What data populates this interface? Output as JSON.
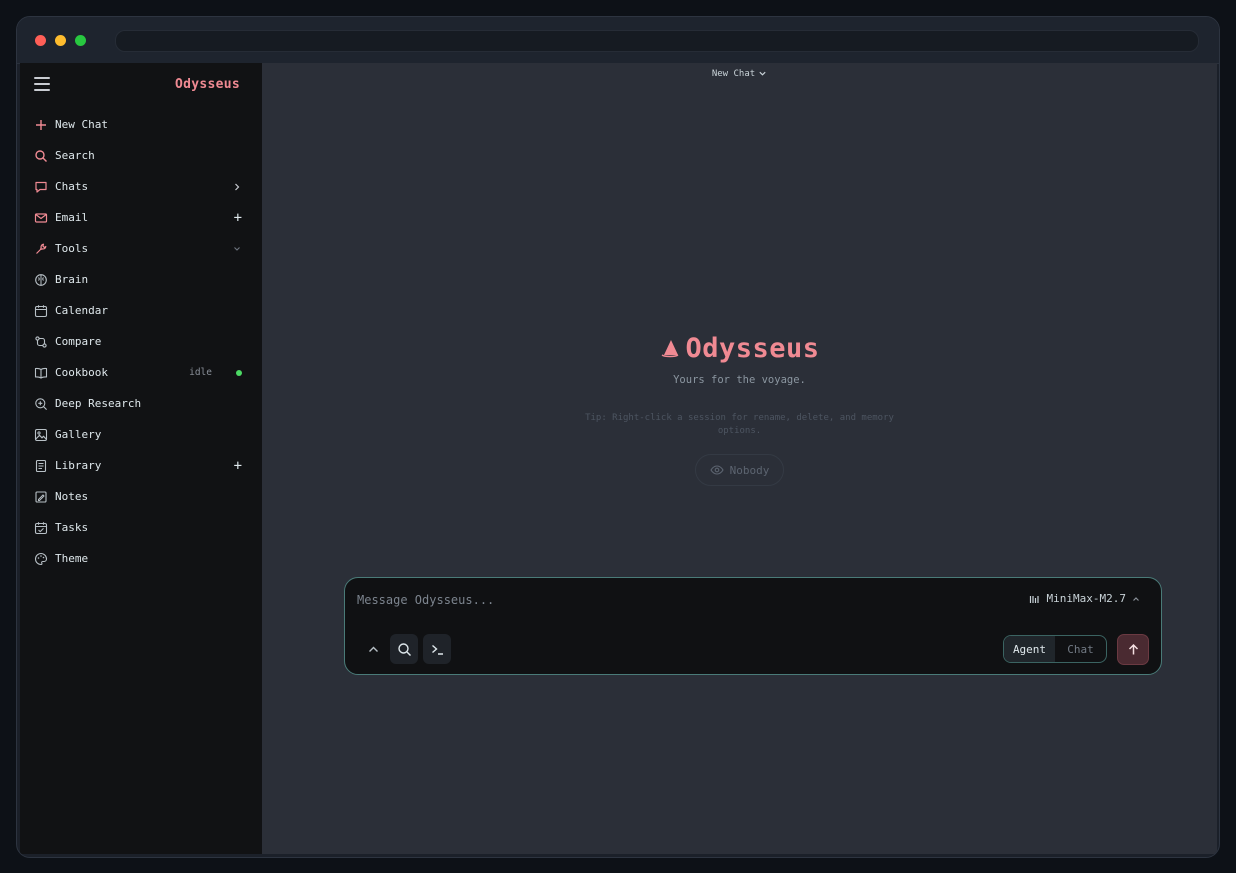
{
  "colors": {
    "accent": "#f08a93",
    "sidebar_bg": "#111214",
    "main_bg": "#2b2f38",
    "composer_border": "#4a7b78",
    "status_idle": "#4cd964"
  },
  "sidebar": {
    "brand": "Odysseus",
    "menu_icon": "hamburger-icon",
    "items": [
      {
        "label": "New Chat",
        "icon": "plus-icon"
      },
      {
        "label": "Search",
        "icon": "search-icon"
      },
      {
        "label": "Chats",
        "icon": "chat-bubble-icon",
        "right": "chevron-right"
      },
      {
        "label": "Email",
        "icon": "mail-icon",
        "right": "plus"
      },
      {
        "label": "Tools",
        "icon": "wrench-icon",
        "right": "chevron-down"
      },
      {
        "label": "Brain",
        "icon": "brain-icon"
      },
      {
        "label": "Calendar",
        "icon": "calendar-icon"
      },
      {
        "label": "Compare",
        "icon": "compare-icon"
      },
      {
        "label": "Cookbook",
        "icon": "book-open-icon",
        "status": "idle"
      },
      {
        "label": "Deep Research",
        "icon": "research-icon"
      },
      {
        "label": "Gallery",
        "icon": "image-icon"
      },
      {
        "label": "Library",
        "icon": "library-icon",
        "right": "plus"
      },
      {
        "label": "Notes",
        "icon": "notes-icon"
      },
      {
        "label": "Tasks",
        "icon": "tasks-icon"
      },
      {
        "label": "Theme",
        "icon": "palette-icon"
      }
    ]
  },
  "main": {
    "session_selector": "New Chat",
    "hero_title": "Odysseus",
    "tagline": "Yours for the voyage.",
    "tip": "Tip: Right-click a session for rename, delete, and memory options.",
    "visibility": "Nobody"
  },
  "composer": {
    "placeholder": "Message Odysseus...",
    "value": "",
    "model": "MiniMax-M2.7",
    "modes": [
      "Agent",
      "Chat"
    ],
    "active_mode": "Agent"
  }
}
